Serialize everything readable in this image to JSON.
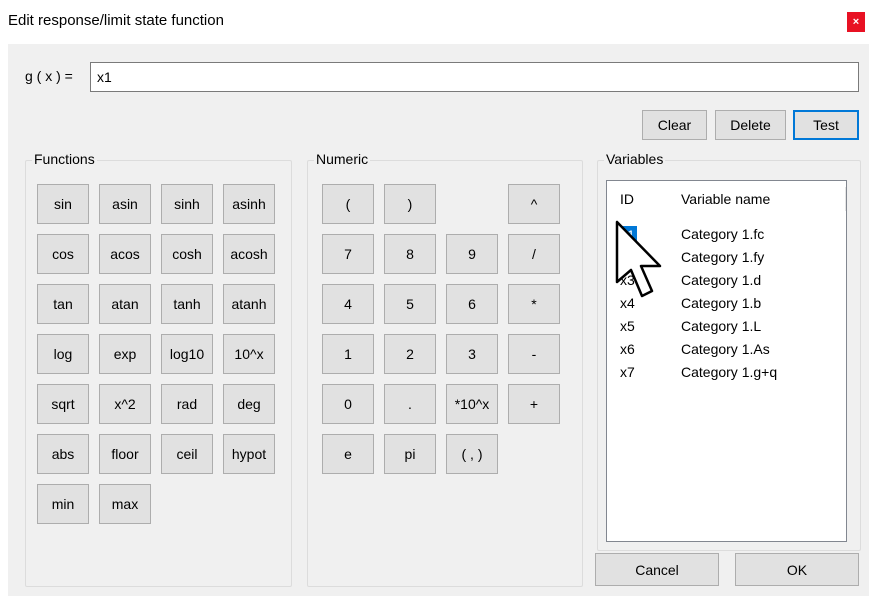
{
  "window": {
    "title": "Edit response/limit state function",
    "close_glyph": "×"
  },
  "expression": {
    "label": "g ( x ) =",
    "value": "x1"
  },
  "actions": {
    "clear": "Clear",
    "delete": "Delete",
    "test": "Test"
  },
  "functions": {
    "title": "Functions",
    "buttons": [
      "sin",
      "asin",
      "sinh",
      "asinh",
      "cos",
      "acos",
      "cosh",
      "acosh",
      "tan",
      "atan",
      "tanh",
      "atanh",
      "log",
      "exp",
      "log10",
      "10^x",
      "sqrt",
      "x^2",
      "rad",
      "deg",
      "abs",
      "floor",
      "ceil",
      "hypot",
      "min",
      "max"
    ]
  },
  "numeric": {
    "title": "Numeric",
    "buttons": [
      "(",
      ")",
      "^",
      "7",
      "8",
      "9",
      "/",
      "4",
      "5",
      "6",
      "*",
      "1",
      "2",
      "3",
      "-",
      "0",
      ".",
      "*10^x",
      "+",
      "e",
      "pi",
      "( , )"
    ]
  },
  "variables": {
    "title": "Variables",
    "col_id": "ID",
    "col_name": "Variable name",
    "rows": [
      {
        "id": "x1",
        "name": "Category 1.fc"
      },
      {
        "id": "x2",
        "name": "Category 1.fy"
      },
      {
        "id": "x3",
        "name": "Category 1.d"
      },
      {
        "id": "x4",
        "name": "Category 1.b"
      },
      {
        "id": "x5",
        "name": "Category 1.L"
      },
      {
        "id": "x6",
        "name": "Category 1.As"
      },
      {
        "id": "x7",
        "name": "Category 1.g+q"
      }
    ],
    "selected": "x1"
  },
  "footer": {
    "cancel": "Cancel",
    "ok": "OK"
  },
  "colors": {
    "accent": "#0078d7",
    "close": "#e81123",
    "dialog_bg": "#f0f0f0"
  }
}
